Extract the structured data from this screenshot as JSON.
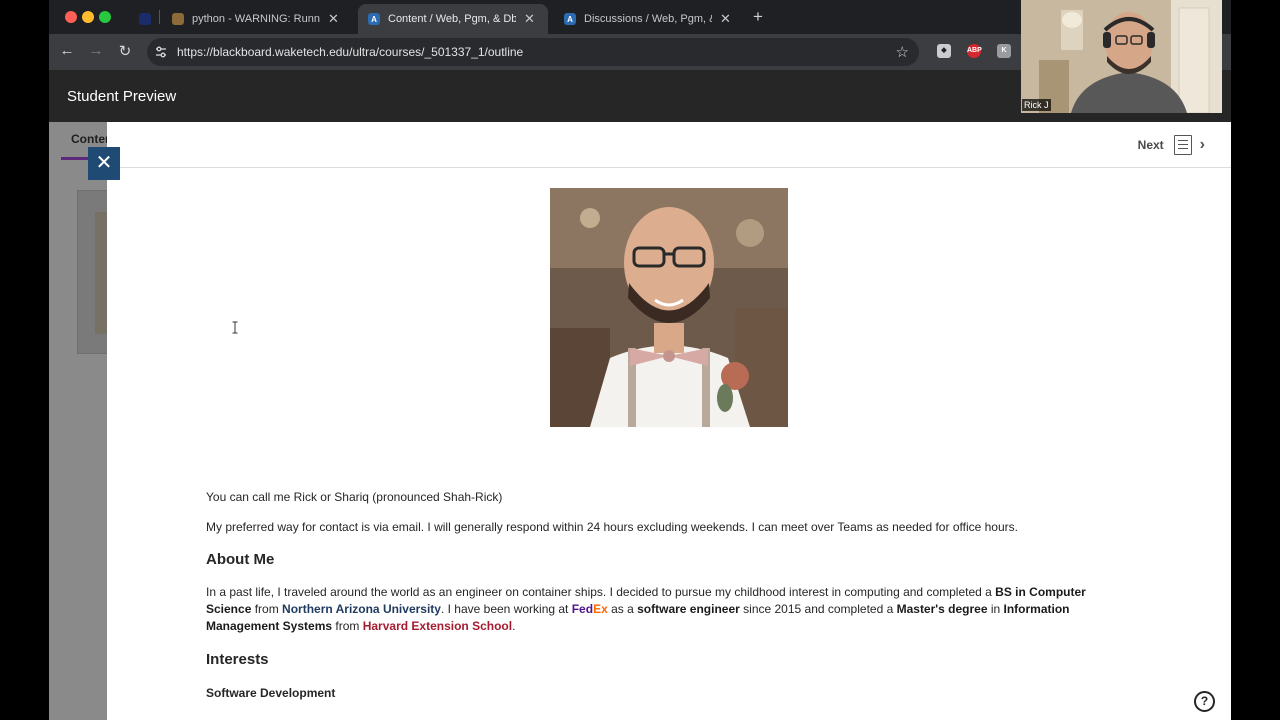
{
  "browser": {
    "tabs": [
      {
        "label": "python - WARNING: Running",
        "active": false
      },
      {
        "label": "Content / Web, Pgm, & Db Fo",
        "active": true
      },
      {
        "label": "Discussions / Web, Pgm, & Db",
        "active": false
      }
    ],
    "url": "https://blackboard.waketech.edu/ultra/courses/_501337_1/outline",
    "extensions": [
      "shield-ext",
      "ABP",
      "K"
    ]
  },
  "header": {
    "title": "Student Preview"
  },
  "behind": {
    "tab_label": "Conter"
  },
  "panel": {
    "next_label": "Next",
    "intro_line_1": "You can call me Rick or Shariq (pronounced Shah-Rick)",
    "intro_line_2": "My preferred way for contact is via email. I will generally respond within 24 hours excluding weekends. I can meet over Teams as needed for office hours.",
    "about_heading": "About Me",
    "about": {
      "t1": "In a past life, I traveled around the world as an engineer on container ships. I decided to pursue my childhood interest in computing and completed a ",
      "b1": "BS in Computer Science",
      "t2": " from ",
      "nau": "Northern Arizona University",
      "t3": ". I have been working at ",
      "fed": "Fed",
      "ex": "Ex",
      "t4": " as a ",
      "b2": "software engineer",
      "t5": " since 2015 and completed a ",
      "b3": "Master's degree",
      "t6": " in ",
      "b4": "Information Management Systems",
      "t7": " from ",
      "harvard": "Harvard Extension School",
      "t8": "."
    },
    "interests_heading": "Interests",
    "interest_1": "Software Development"
  },
  "webcam": {
    "name": "Rick J"
  },
  "colors": {
    "bb_header": "#262626",
    "close_button": "#1e4a73",
    "fedex_purple": "#4d148c",
    "fedex_orange": "#ff6600",
    "harvard_crimson": "#a51c30"
  }
}
